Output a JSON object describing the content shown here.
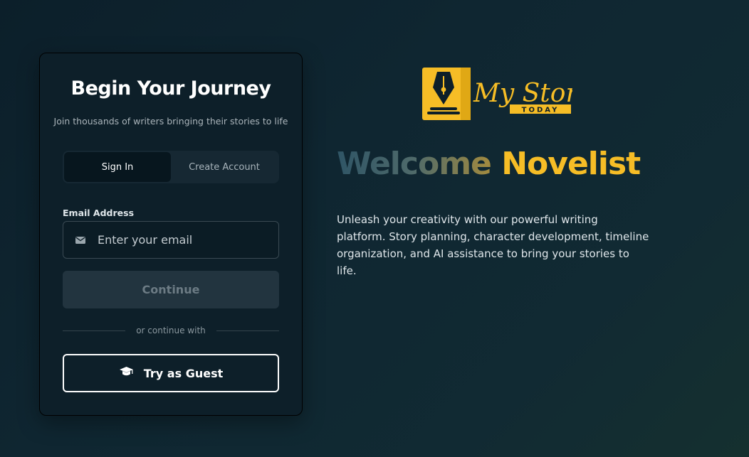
{
  "card": {
    "title": "Begin Your Journey",
    "subtitle": "Join thousands of writers bringing their stories to life",
    "tabs": [
      {
        "label": "Sign In",
        "active": true
      },
      {
        "label": "Create Account",
        "active": false
      }
    ],
    "email": {
      "label": "Email Address",
      "placeholder": "Enter your email",
      "value": "",
      "icon": "mail-icon"
    },
    "continue_label": "Continue",
    "divider_text": "or continue with",
    "guest": {
      "label": "Try as Guest",
      "icon": "graduation-cap-icon"
    }
  },
  "brand": {
    "logo_script": "My Story",
    "logo_badge": "TODAY",
    "logo_icon": "fountain-pen-nib-icon",
    "accent_color": "#f6bd26"
  },
  "hero": {
    "welcome_word": "Welcome",
    "highlight_word": "Novelist",
    "description": "Unleash your creativity with our powerful writing platform. Story planning, character development, timeline organization, and AI assistance to bring your stories to life."
  }
}
